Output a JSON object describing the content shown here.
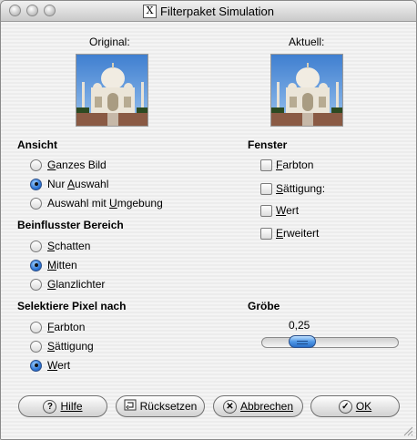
{
  "window": {
    "title": "Filterpaket Simulation"
  },
  "images": {
    "original_label": "Original:",
    "current_label": "Aktuell:"
  },
  "ansicht": {
    "heading": "Ansicht",
    "options": [
      {
        "label": "Ganzes Bild",
        "mnemonic_char": "G",
        "selected": false
      },
      {
        "label": "Nur Auswahl",
        "mnemonic_char": "A",
        "selected": true
      },
      {
        "label": "Auswahl mit Umgebung",
        "mnemonic_char": "U",
        "selected": false
      }
    ]
  },
  "bereich": {
    "heading": "Beinflusster Bereich",
    "options": [
      {
        "label": "Schatten",
        "mnemonic_char": "S",
        "selected": false
      },
      {
        "label": "Mitten",
        "mnemonic_char": "M",
        "selected": true
      },
      {
        "label": "Glanzlichter",
        "mnemonic_char": "G",
        "selected": false
      }
    ]
  },
  "pixel": {
    "heading": "Selektiere Pixel nach",
    "options": [
      {
        "label": "Farbton",
        "mnemonic_char": "F",
        "selected": false
      },
      {
        "label": "Sättigung",
        "mnemonic_char": "S",
        "selected": false
      },
      {
        "label": "Wert",
        "mnemonic_char": "W",
        "selected": true
      }
    ]
  },
  "fenster": {
    "heading": "Fenster",
    "options": [
      {
        "label": "Farbton",
        "mnemonic_char": "F",
        "checked": false
      },
      {
        "label": "Sättigung:",
        "mnemonic_char": "S",
        "checked": false
      },
      {
        "label": "Wert",
        "mnemonic_char": "W",
        "checked": false
      },
      {
        "label": "Erweitert",
        "mnemonic_char": "E",
        "checked": false
      }
    ]
  },
  "groebe": {
    "heading": "Gröbe",
    "value": "0,25",
    "position_fraction": 0.25
  },
  "buttons": {
    "help": "Hilfe",
    "reset": "Rücksetzen",
    "cancel": "Abbrechen",
    "ok": "OK"
  },
  "colors": {
    "accent": "#2f77d6",
    "window_bg": "#ececec"
  }
}
